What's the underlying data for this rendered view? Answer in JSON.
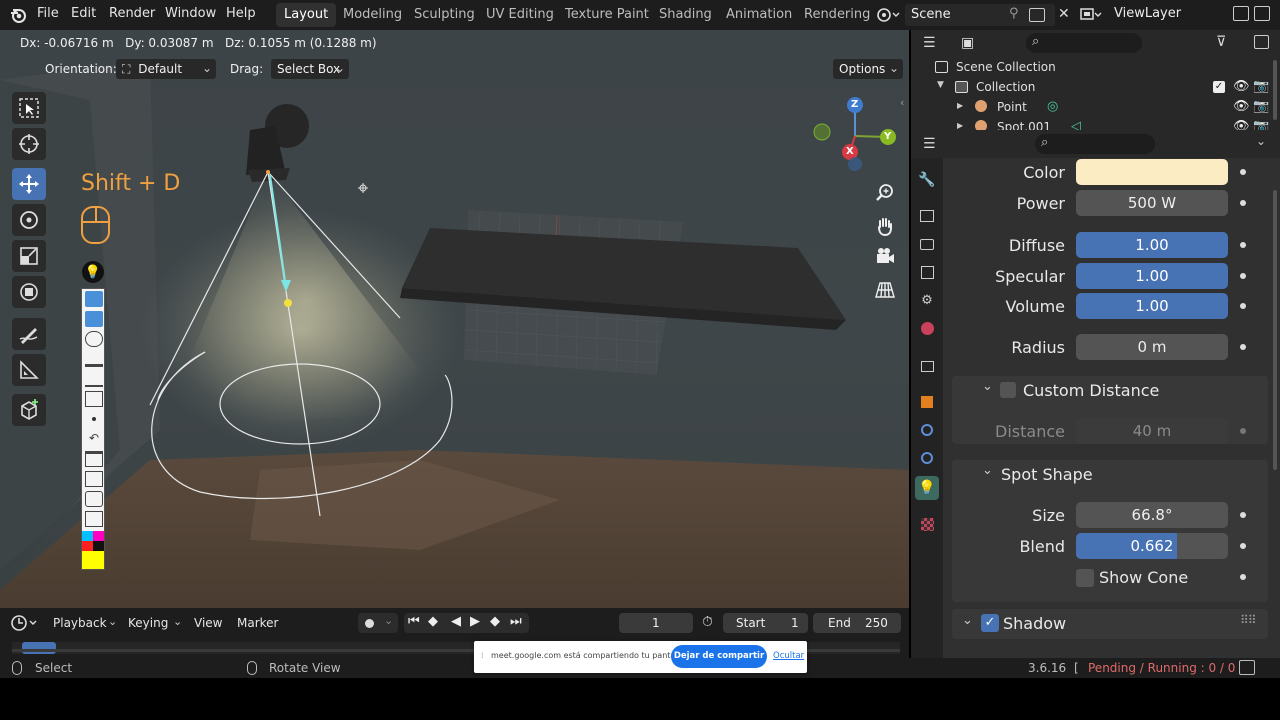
{
  "menu": [
    "File",
    "Edit",
    "Render",
    "Window",
    "Help"
  ],
  "workspaces": [
    "Layout",
    "Modeling",
    "Sculpting",
    "UV Editing",
    "Texture Paint",
    "Shading",
    "Animation",
    "Rendering"
  ],
  "scene_name": "Scene",
  "view_layer": "ViewLayer",
  "viewport": {
    "transform_readout": "Dx: -0.06716 m   Dy: 0.03087 m   Dz: 0.1055 m (0.1288 m)",
    "orientation_label": "Orientation:",
    "orientation_value": "Default",
    "drag_label": "Drag:",
    "drag_value": "Select Box",
    "options_label": "Options",
    "shortcut_overlay": "Shift + D",
    "gizmo": {
      "z": "Z",
      "y": "Y",
      "x": "X"
    }
  },
  "timeline": {
    "playback": "Playback",
    "keying": "Keying",
    "view": "View",
    "marker": "Marker",
    "current_frame": "1",
    "start_label": "Start",
    "start_value": "1",
    "end_label": "End",
    "end_value": "250"
  },
  "statusbar": {
    "select": "Select",
    "rotate": "Rotate View",
    "version": "3.6.16",
    "status": "Pending / Running : 0 / 0"
  },
  "outliner": {
    "root": "Scene Collection",
    "collection": "Collection",
    "items": [
      "Point",
      "Spot.001"
    ]
  },
  "properties": {
    "color_label": "Color",
    "color_value": "#fbecc4",
    "power_label": "Power",
    "power_value": "500 W",
    "diffuse_label": "Diffuse",
    "diffuse_value": "1.00",
    "specular_label": "Specular",
    "specular_value": "1.00",
    "volume_label": "Volume",
    "volume_value": "1.00",
    "radius_label": "Radius",
    "radius_value": "0 m",
    "custom_distance_title": "Custom Distance",
    "distance_label": "Distance",
    "distance_value": "40 m",
    "spot_shape_title": "Spot Shape",
    "size_label": "Size",
    "size_value": "66.8°",
    "blend_label": "Blend",
    "blend_value": "0.662",
    "blend_fraction": 0.662,
    "show_cone_label": "Show Cone",
    "shadow_title": "Shadow",
    "shadow_enabled": true
  },
  "share_popup": {
    "message": "meet.google.com está compartiendo tu pantalla.",
    "stop_button": "Dejar de compartir",
    "hide_link": "Ocultar"
  },
  "colors": {
    "accent": "#4772b3",
    "active_tab": "#3d6a5e",
    "overlay_text": "#f0a040"
  }
}
